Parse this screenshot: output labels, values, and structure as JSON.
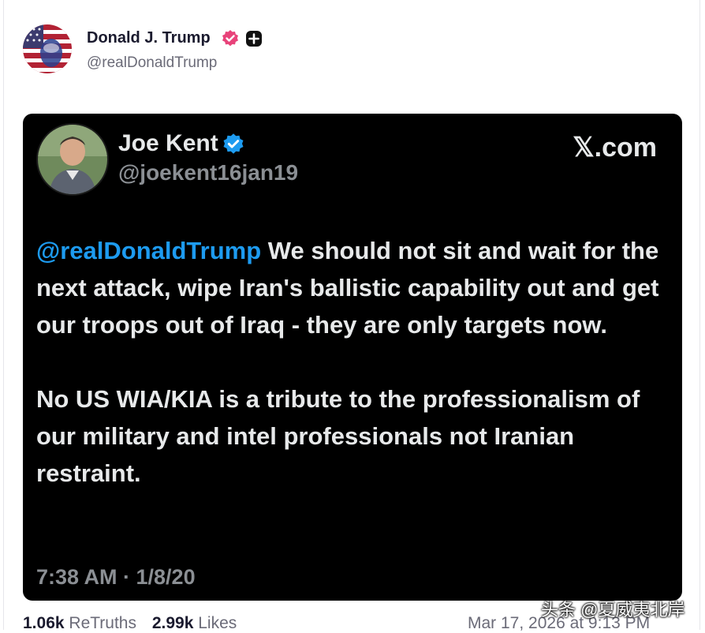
{
  "post": {
    "author_name": "Donald J. Trump",
    "author_handle": "@realDonaldTrump",
    "verified_icon": "verified-badge-icon",
    "plus_icon": "plus-badge-icon",
    "stats": {
      "retruths_count": "1.06k",
      "retruths_label": "ReTruths",
      "likes_count": "2.99k",
      "likes_label": "Likes"
    },
    "date": "Mar 17, 2026 at 9:13 PM"
  },
  "quote_card": {
    "author_name": "Joe Kent",
    "author_handle": "@joekent16jan19",
    "site": "𝕏.com",
    "mention": "@realDonaldTrump",
    "paragraph1_rest": "We should not sit and wait for the next attack, wipe Iran's ballistic capability out and get our troops out of Iraq - they are only targets now.",
    "paragraph2": "No US WIA/KIA is a tribute to the professionalism of our military and intel professionals not Iranian restraint.",
    "timestamp": "7:38 AM · 1/8/20"
  },
  "watermark": "头条 @夏威夷北岸",
  "colors": {
    "mention_blue": "#1d9bf0",
    "card_bg": "#000000",
    "badge_pink": "#e8437a",
    "badge_blue": "#1d9bf0"
  }
}
